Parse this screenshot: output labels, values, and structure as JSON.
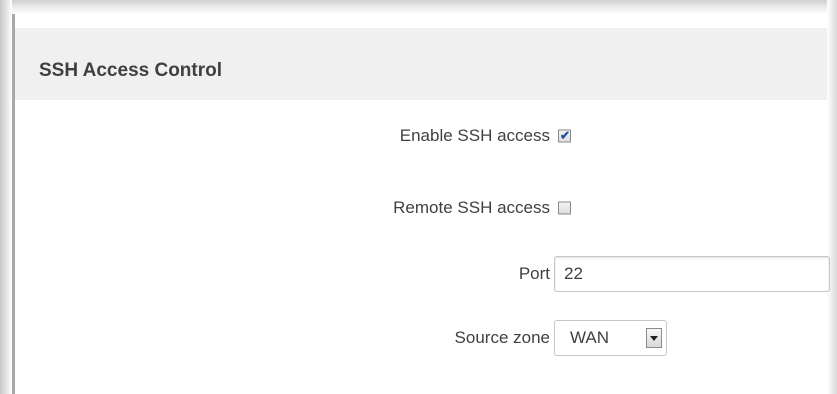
{
  "section": {
    "title": "SSH Access Control"
  },
  "fields": {
    "enable_ssh": {
      "label": "Enable SSH access",
      "checked": true
    },
    "remote_ssh": {
      "label": "Remote SSH access",
      "checked": false
    },
    "port": {
      "label": "Port",
      "value": "22"
    },
    "source_zone": {
      "label": "Source zone",
      "value": "WAN"
    }
  },
  "icons": {
    "checkmark": "checkmark-icon",
    "dropdown": "chevron-down-icon"
  },
  "colors": {
    "header_bg": "#f0f0f0",
    "text": "#404040",
    "checkmark": "#1f4e9a"
  }
}
